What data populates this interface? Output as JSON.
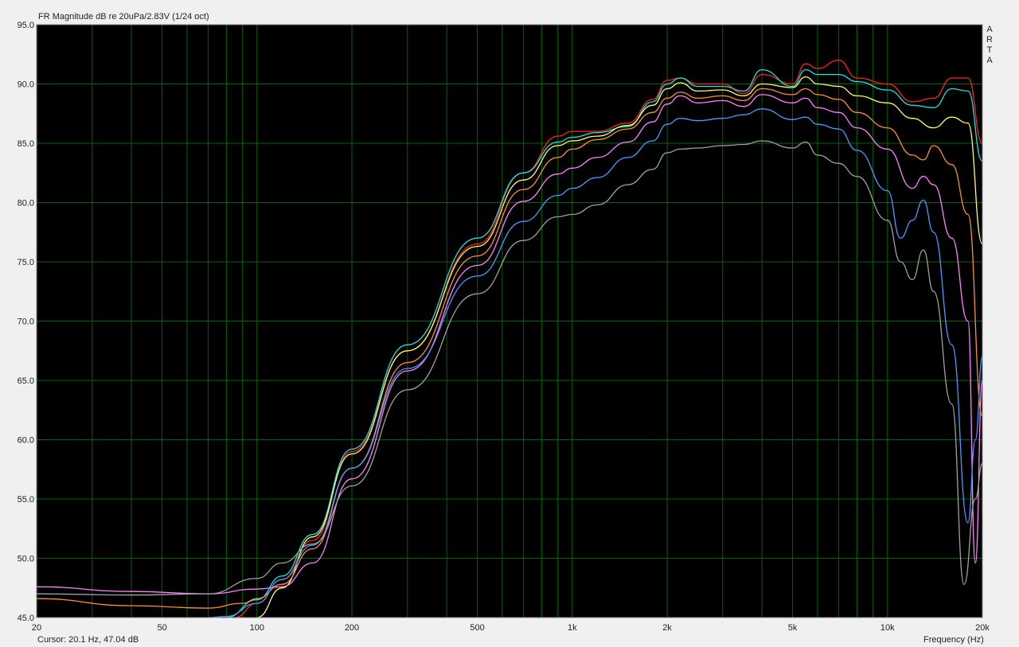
{
  "chart_data": {
    "type": "line",
    "title": "FR Magnitude dB re 20uPa/2.83V (1/24 oct)",
    "xlabel": "Frequency (Hz)",
    "ylabel": "",
    "xscale": "log",
    "xlim": [
      20,
      20000
    ],
    "ylim": [
      45,
      95
    ],
    "grid": true,
    "legend": "none",
    "x_tick_labels": [
      {
        "value": 20,
        "label": "20"
      },
      {
        "value": 50,
        "label": "50"
      },
      {
        "value": 100,
        "label": "100"
      },
      {
        "value": 200,
        "label": "200"
      },
      {
        "value": 500,
        "label": "500"
      },
      {
        "value": 1000,
        "label": "1k"
      },
      {
        "value": 2000,
        "label": "2k"
      },
      {
        "value": 5000,
        "label": "5k"
      },
      {
        "value": 10000,
        "label": "10k"
      },
      {
        "value": 20000,
        "label": "20k"
      }
    ],
    "y_tick_labels": [
      "45.0",
      "50.0",
      "55.0",
      "60.0",
      "65.0",
      "70.0",
      "75.0",
      "80.0",
      "85.0",
      "90.0",
      "95.0"
    ],
    "series": [
      {
        "color": "#ff2020",
        "points": [
          [
            85,
            45
          ],
          [
            100,
            46.2
          ],
          [
            120,
            48.2
          ],
          [
            150,
            51.5
          ],
          [
            200,
            59
          ],
          [
            300,
            67.5
          ],
          [
            500,
            76.5
          ],
          [
            700,
            82.5
          ],
          [
            900,
            85.6
          ],
          [
            1000,
            86
          ],
          [
            1200,
            86
          ],
          [
            1500,
            86.7
          ],
          [
            1800,
            88.7
          ],
          [
            2000,
            90.3
          ],
          [
            2200,
            90.5
          ],
          [
            2500,
            90
          ],
          [
            3000,
            90
          ],
          [
            3500,
            89.2
          ],
          [
            4000,
            90.8
          ],
          [
            5000,
            90
          ],
          [
            5500,
            91.7
          ],
          [
            6000,
            91.3
          ],
          [
            7000,
            92
          ],
          [
            8000,
            90.5
          ],
          [
            10000,
            90
          ],
          [
            12000,
            88.5
          ],
          [
            14000,
            88.8
          ],
          [
            16000,
            90.5
          ],
          [
            18000,
            90.5
          ],
          [
            20000,
            85
          ]
        ]
      },
      {
        "color": "#20e0e0",
        "points": [
          [
            80,
            45
          ],
          [
            100,
            46.5
          ],
          [
            120,
            48.5
          ],
          [
            150,
            52
          ],
          [
            200,
            59.2
          ],
          [
            300,
            68
          ],
          [
            500,
            77
          ],
          [
            700,
            82.5
          ],
          [
            900,
            85.1
          ],
          [
            1000,
            85.5
          ],
          [
            1200,
            85.9
          ],
          [
            1500,
            86.4
          ],
          [
            1800,
            88.5
          ],
          [
            2000,
            90
          ],
          [
            2200,
            90.5
          ],
          [
            2500,
            89.8
          ],
          [
            3000,
            89.8
          ],
          [
            3500,
            89.4
          ],
          [
            4000,
            91.2
          ],
          [
            5000,
            89.8
          ],
          [
            5500,
            91.2
          ],
          [
            6000,
            90.8
          ],
          [
            7000,
            90.8
          ],
          [
            8000,
            90.2
          ],
          [
            10000,
            89.5
          ],
          [
            12000,
            88.2
          ],
          [
            14000,
            88
          ],
          [
            16000,
            89.6
          ],
          [
            18000,
            89.4
          ],
          [
            20000,
            83.5
          ]
        ]
      },
      {
        "color": "#ffff60",
        "points": [
          [
            100,
            45
          ],
          [
            120,
            47.5
          ],
          [
            150,
            51.8
          ],
          [
            200,
            58.8
          ],
          [
            300,
            67.5
          ],
          [
            500,
            76.3
          ],
          [
            700,
            81.9
          ],
          [
            900,
            84.8
          ],
          [
            1000,
            85.2
          ],
          [
            1200,
            85.6
          ],
          [
            1500,
            86.5
          ],
          [
            1800,
            88.2
          ],
          [
            2000,
            89.6
          ],
          [
            2200,
            90.1
          ],
          [
            2500,
            89.4
          ],
          [
            3000,
            89.5
          ],
          [
            3500,
            89
          ],
          [
            4000,
            90
          ],
          [
            5000,
            89.7
          ],
          [
            5500,
            90.6
          ],
          [
            6000,
            90
          ],
          [
            7000,
            89.8
          ],
          [
            8000,
            89
          ],
          [
            10000,
            88.4
          ],
          [
            12000,
            87.1
          ],
          [
            14000,
            86.3
          ],
          [
            16000,
            87.2
          ],
          [
            18000,
            86.7
          ],
          [
            20000,
            76.5
          ]
        ]
      },
      {
        "color": "#ff9030",
        "points": [
          [
            20,
            46.6
          ],
          [
            40,
            46
          ],
          [
            70,
            45.8
          ],
          [
            90,
            46.2
          ],
          [
            100,
            46.6
          ],
          [
            120,
            47.8
          ],
          [
            150,
            50.8
          ],
          [
            200,
            57.6
          ],
          [
            300,
            66.5
          ],
          [
            500,
            75.5
          ],
          [
            700,
            81.1
          ],
          [
            900,
            83.8
          ],
          [
            1000,
            84.5
          ],
          [
            1200,
            85.3
          ],
          [
            1500,
            86.2
          ],
          [
            1800,
            87.6
          ],
          [
            2000,
            88.8
          ],
          [
            2200,
            89.3
          ],
          [
            2500,
            88.8
          ],
          [
            3000,
            89
          ],
          [
            3500,
            88.6
          ],
          [
            4000,
            89.6
          ],
          [
            5000,
            89.1
          ],
          [
            5500,
            89.6
          ],
          [
            6000,
            89.1
          ],
          [
            7000,
            88.7
          ],
          [
            8000,
            87.6
          ],
          [
            10000,
            86.3
          ],
          [
            12000,
            84
          ],
          [
            13000,
            83.6
          ],
          [
            14000,
            84.8
          ],
          [
            16000,
            83.2
          ],
          [
            18000,
            79
          ],
          [
            20000,
            62
          ]
        ]
      },
      {
        "color": "#ff80ff",
        "points": [
          [
            20,
            47.6
          ],
          [
            40,
            47.2
          ],
          [
            70,
            47
          ],
          [
            100,
            47.4
          ],
          [
            120,
            47.6
          ],
          [
            150,
            49.6
          ],
          [
            200,
            56.7
          ],
          [
            300,
            65.8
          ],
          [
            500,
            74.7
          ],
          [
            700,
            80.1
          ],
          [
            900,
            82.4
          ],
          [
            1000,
            82.9
          ],
          [
            1200,
            83.8
          ],
          [
            1500,
            85.1
          ],
          [
            1800,
            86.8
          ],
          [
            2000,
            88.3
          ],
          [
            2200,
            89
          ],
          [
            2500,
            88.4
          ],
          [
            3000,
            88.6
          ],
          [
            3500,
            88.1
          ],
          [
            4000,
            89.1
          ],
          [
            5000,
            88.4
          ],
          [
            5500,
            88.8
          ],
          [
            6000,
            88
          ],
          [
            7000,
            87.6
          ],
          [
            8000,
            86.3
          ],
          [
            10000,
            84.5
          ],
          [
            12000,
            81.2
          ],
          [
            13000,
            82.2
          ],
          [
            14000,
            81.5
          ],
          [
            16000,
            77
          ],
          [
            18000,
            70
          ],
          [
            19000,
            49.6
          ],
          [
            20000,
            65
          ]
        ]
      },
      {
        "color": "#4a9aff",
        "points": [
          [
            70,
            45
          ],
          [
            80,
            45.1
          ],
          [
            100,
            46.2
          ],
          [
            120,
            48.2
          ],
          [
            150,
            51.1
          ],
          [
            200,
            57.6
          ],
          [
            300,
            66
          ],
          [
            500,
            73.8
          ],
          [
            700,
            78.4
          ],
          [
            900,
            80.6
          ],
          [
            1000,
            81.2
          ],
          [
            1200,
            82.1
          ],
          [
            1500,
            83.8
          ],
          [
            1800,
            85.2
          ],
          [
            2000,
            86.6
          ],
          [
            2200,
            87.1
          ],
          [
            2500,
            86.9
          ],
          [
            3000,
            87.1
          ],
          [
            3500,
            87.4
          ],
          [
            4000,
            87.9
          ],
          [
            5000,
            87
          ],
          [
            5500,
            87.2
          ],
          [
            6000,
            86.6
          ],
          [
            7000,
            86.2
          ],
          [
            8000,
            84.4
          ],
          [
            10000,
            81
          ],
          [
            11000,
            77
          ],
          [
            12000,
            78.5
          ],
          [
            13000,
            80.2
          ],
          [
            14000,
            77.5
          ],
          [
            16000,
            68
          ],
          [
            18000,
            53
          ],
          [
            19000,
            60
          ],
          [
            20000,
            67
          ]
        ]
      },
      {
        "color": "#a0a0a0",
        "points": [
          [
            20,
            47
          ],
          [
            40,
            46.9
          ],
          [
            70,
            47
          ],
          [
            100,
            48.3
          ],
          [
            120,
            49.6
          ],
          [
            150,
            51.2
          ],
          [
            200,
            56.1
          ],
          [
            300,
            64.2
          ],
          [
            500,
            72.3
          ],
          [
            700,
            76.8
          ],
          [
            900,
            78.8
          ],
          [
            1000,
            79
          ],
          [
            1200,
            79.8
          ],
          [
            1500,
            81.5
          ],
          [
            1800,
            82.8
          ],
          [
            2000,
            84.2
          ],
          [
            2200,
            84.5
          ],
          [
            2500,
            84.6
          ],
          [
            3000,
            84.8
          ],
          [
            3500,
            84.9
          ],
          [
            4000,
            85.2
          ],
          [
            5000,
            84.6
          ],
          [
            5500,
            85.1
          ],
          [
            6000,
            84
          ],
          [
            7000,
            83.3
          ],
          [
            8000,
            82.2
          ],
          [
            10000,
            78.5
          ],
          [
            11000,
            75
          ],
          [
            12000,
            73.5
          ],
          [
            13000,
            76
          ],
          [
            14000,
            72.5
          ],
          [
            16000,
            63
          ],
          [
            17500,
            47.8
          ],
          [
            19000,
            55
          ],
          [
            20000,
            58
          ]
        ]
      }
    ]
  },
  "cursor_readout": "Cursor: 20.1 Hz, 47.04 dB",
  "watermark": "A R T A",
  "colors": {
    "plot_bg": "#000000",
    "grid": "#006400",
    "page_bg": "#f0f0f0"
  }
}
